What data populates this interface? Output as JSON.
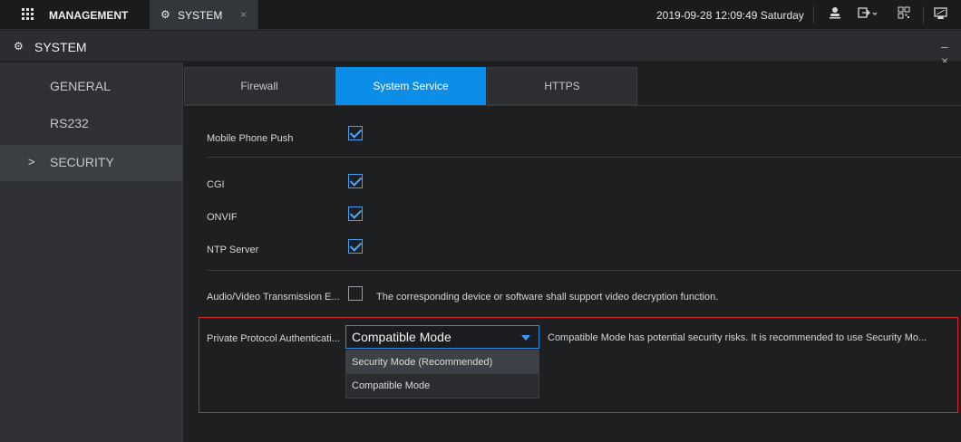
{
  "topbar": {
    "menu_label": "MANAGEMENT",
    "tab_label": "SYSTEM",
    "tab_close": "×",
    "datetime": "2019-09-28 12:09:49 Saturday"
  },
  "header": {
    "title": "SYSTEM",
    "window_controls": "– ×"
  },
  "sidebar": {
    "items": [
      {
        "label": "GENERAL",
        "active": false
      },
      {
        "label": "RS232",
        "active": false
      },
      {
        "label": "SECURITY",
        "active": true
      }
    ],
    "active_chevron": ">"
  },
  "tabs": [
    {
      "label": "Firewall",
      "active": false
    },
    {
      "label": "System Service",
      "active": true
    },
    {
      "label": "HTTPS",
      "active": false
    }
  ],
  "settings": {
    "mobile_push": {
      "label": "Mobile Phone Push",
      "checked": true
    },
    "cgi": {
      "label": "CGI",
      "checked": true
    },
    "onvif": {
      "label": "ONVIF",
      "checked": true
    },
    "ntp": {
      "label": "NTP Server",
      "checked": true
    },
    "av_encrypt": {
      "label": "Audio/Video Transmission E...",
      "checked": false,
      "note": "The corresponding device or software shall support video decryption function."
    },
    "private_auth": {
      "label": "Private Protocol Authenticati...",
      "selected": "Compatible Mode",
      "options": [
        "Security Mode (Recommended)",
        "Compatible Mode"
      ],
      "note": "Compatible Mode has potential security risks. It is recommended to use Security Mo..."
    }
  },
  "colors": {
    "accent": "#0c8ee8",
    "highlight_border": "#d6262c"
  }
}
